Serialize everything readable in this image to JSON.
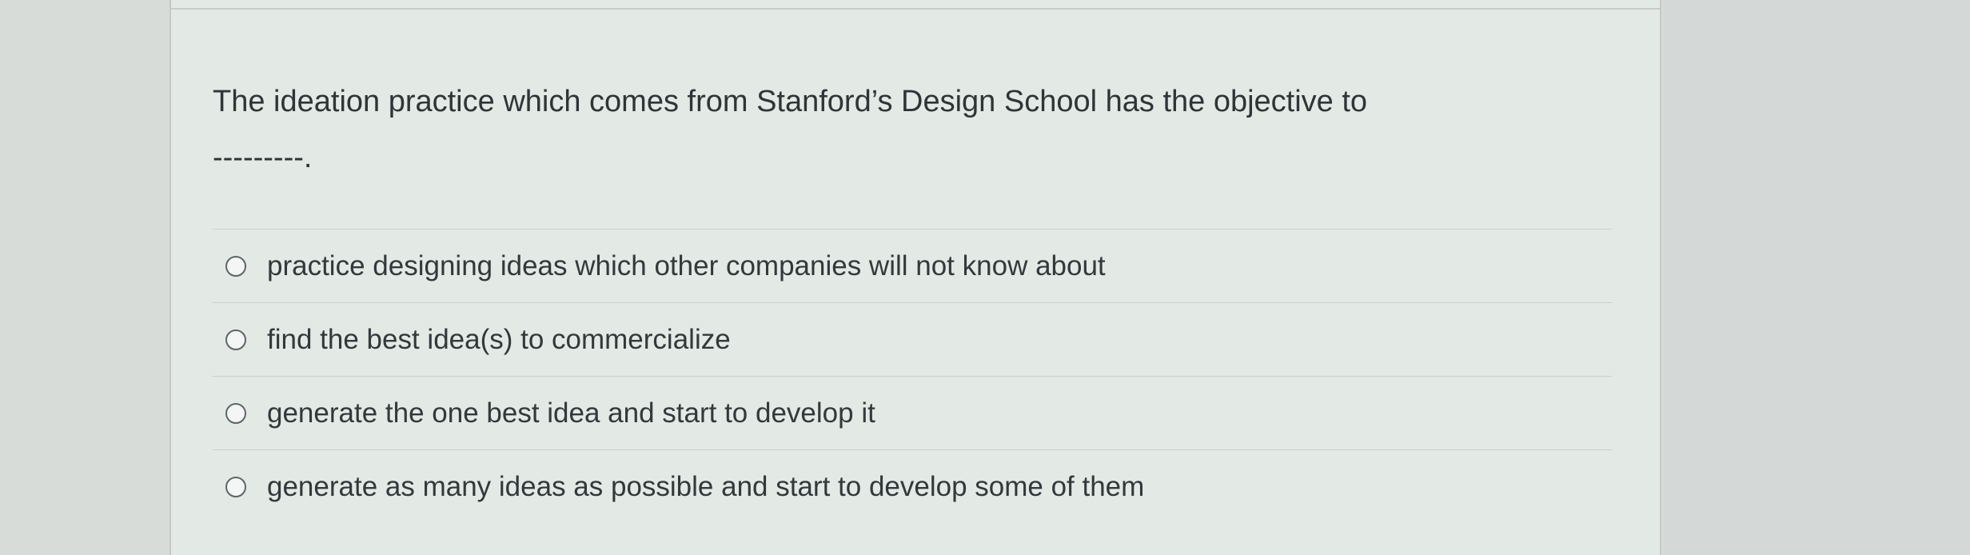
{
  "question": {
    "text": "The ideation practice which comes from Stanford’s Design School has the objective to",
    "blank": "---------."
  },
  "options": [
    {
      "label": "practice designing ideas which other companies will not know about"
    },
    {
      "label": "find the best idea(s) to commercialize"
    },
    {
      "label": "generate the one best idea and start to develop it"
    },
    {
      "label": "generate as many ideas as possible and start to develop some of them"
    }
  ],
  "colors": {
    "card_background": "#e3e9e5",
    "page_background": "#d9dcda",
    "text": "#2f3437"
  }
}
